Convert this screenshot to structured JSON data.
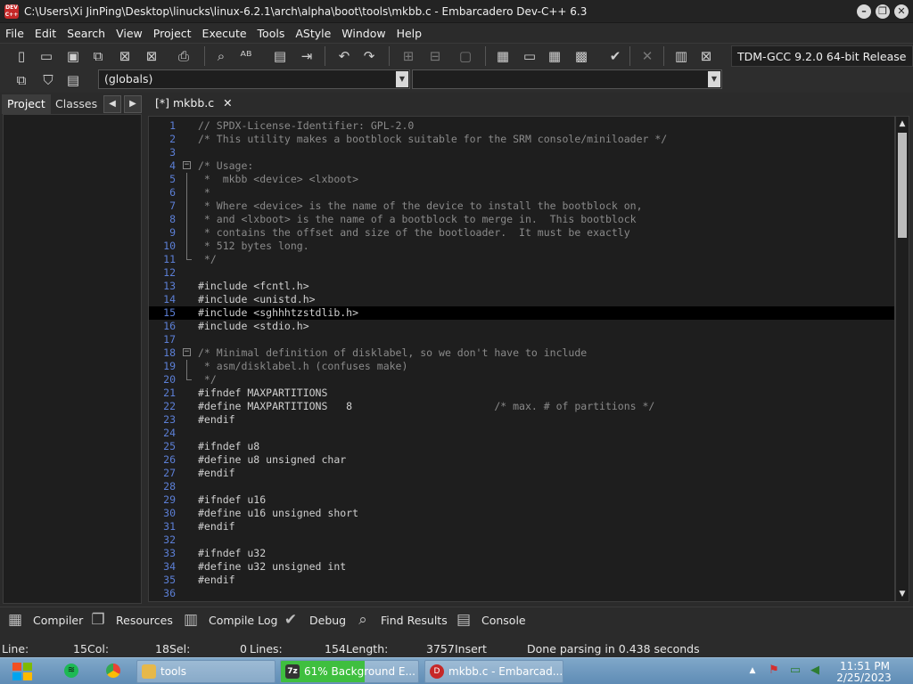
{
  "window": {
    "title": "C:\\Users\\Xi JinPing\\Desktop\\linucks\\linux-6.2.1\\arch\\alpha\\boot\\tools\\mkbb.c - Embarcadero Dev-C++ 6.3",
    "icon_text": "DEV C++",
    "controls": {
      "minimize": "–",
      "restore": "❐",
      "close": "✕"
    }
  },
  "menu": [
    "File",
    "Edit",
    "Search",
    "View",
    "Project",
    "Execute",
    "Tools",
    "AStyle",
    "Window",
    "Help"
  ],
  "toolbar": {
    "compiler": "TDM-GCC 9.2.0 64-bit Release",
    "scope_combo": "(globals)",
    "function_combo": ""
  },
  "left_panel": {
    "tabs": [
      "Project",
      "Classes"
    ],
    "active_tab": "Project",
    "nav_prev": "◀",
    "nav_next": "▶"
  },
  "editor": {
    "tab_label": "[*] mkbb.c",
    "tab_close": "✕",
    "current_line": 15,
    "lines": [
      {
        "n": "1",
        "text": "// SPDX-License-Identifier: GPL-2.0",
        "kind": "comment"
      },
      {
        "n": "2",
        "text": "/* This utility makes a bootblock suitable for the SRM console/miniloader */",
        "kind": "comment"
      },
      {
        "n": "3",
        "text": "",
        "kind": "code"
      },
      {
        "n": "4",
        "text": "/* Usage:",
        "kind": "comment",
        "fold": "start"
      },
      {
        "n": "5",
        "text": " *  mkbb <device> <lxboot>",
        "kind": "comment",
        "fold": "line"
      },
      {
        "n": "6",
        "text": " *",
        "kind": "comment",
        "fold": "line"
      },
      {
        "n": "7",
        "text": " * Where <device> is the name of the device to install the bootblock on,",
        "kind": "comment",
        "fold": "line"
      },
      {
        "n": "8",
        "text": " * and <lxboot> is the name of a bootblock to merge in.  This bootblock",
        "kind": "comment",
        "fold": "line"
      },
      {
        "n": "9",
        "text": " * contains the offset and size of the bootloader.  It must be exactly",
        "kind": "comment",
        "fold": "line"
      },
      {
        "n": "10",
        "text": " * 512 bytes long.",
        "kind": "comment",
        "fold": "line"
      },
      {
        "n": "11",
        "text": " */",
        "kind": "comment",
        "fold": "end"
      },
      {
        "n": "12",
        "text": "",
        "kind": "code"
      },
      {
        "n": "13",
        "text": "#include <fcntl.h>",
        "kind": "pp"
      },
      {
        "n": "14",
        "text": "#include <unistd.h>",
        "kind": "pp"
      },
      {
        "n": "15",
        "text": "#include <sghhhtzstdlib.h>",
        "kind": "pp"
      },
      {
        "n": "16",
        "text": "#include <stdio.h>",
        "kind": "pp"
      },
      {
        "n": "17",
        "text": "",
        "kind": "code"
      },
      {
        "n": "18",
        "text": "/* Minimal definition of disklabel, so we don't have to include",
        "kind": "comment",
        "fold": "start"
      },
      {
        "n": "19",
        "text": " * asm/disklabel.h (confuses make)",
        "kind": "comment",
        "fold": "line"
      },
      {
        "n": "20",
        "text": " */",
        "kind": "comment",
        "fold": "end"
      },
      {
        "n": "21",
        "text": "#ifndef MAXPARTITIONS",
        "kind": "pp"
      },
      {
        "n": "22",
        "text": "#define MAXPARTITIONS   8",
        "trail": "                       /* max. # of partitions */",
        "kind": "pp"
      },
      {
        "n": "23",
        "text": "#endif",
        "kind": "pp"
      },
      {
        "n": "24",
        "text": "",
        "kind": "code"
      },
      {
        "n": "25",
        "text": "#ifndef u8",
        "kind": "pp"
      },
      {
        "n": "26",
        "text": "#define u8 unsigned char",
        "kind": "pp"
      },
      {
        "n": "27",
        "text": "#endif",
        "kind": "pp"
      },
      {
        "n": "28",
        "text": "",
        "kind": "code"
      },
      {
        "n": "29",
        "text": "#ifndef u16",
        "kind": "pp"
      },
      {
        "n": "30",
        "text": "#define u16 unsigned short",
        "kind": "pp"
      },
      {
        "n": "31",
        "text": "#endif",
        "kind": "pp"
      },
      {
        "n": "32",
        "text": "",
        "kind": "code"
      },
      {
        "n": "33",
        "text": "#ifndef u32",
        "kind": "pp"
      },
      {
        "n": "34",
        "text": "#define u32 unsigned int",
        "kind": "pp"
      },
      {
        "n": "35",
        "text": "#endif",
        "kind": "pp"
      },
      {
        "n": "36",
        "text": "",
        "kind": "code"
      }
    ]
  },
  "bottom_tabs": [
    {
      "label": "Compiler",
      "icon": "grid-icon",
      "glyph": "▦"
    },
    {
      "label": "Resources",
      "icon": "resources-icon",
      "glyph": "❐"
    },
    {
      "label": "Compile Log",
      "icon": "chart-icon",
      "glyph": "▥"
    },
    {
      "label": "Debug",
      "icon": "check-icon",
      "glyph": "✔"
    },
    {
      "label": "Find Results",
      "icon": "find-icon",
      "glyph": "⌕"
    },
    {
      "label": "Console",
      "icon": "console-icon",
      "glyph": "▤"
    }
  ],
  "statusbar": {
    "line_label": "Line:",
    "line_value": "15",
    "col_label": "Col:",
    "col_value": "18",
    "sel_label": "Sel:",
    "sel_value": "0",
    "lines_label": "Lines:",
    "lines_value": "154",
    "length_label": "Length:",
    "length_value": "3757",
    "mode": "Insert",
    "message": "Done parsing in 0.438 seconds"
  },
  "taskbar": {
    "items": [
      {
        "label": "tools",
        "icon": "folder-icon",
        "color": "#e6b84a"
      },
      {
        "label": "61% Background E...",
        "icon": "7zip-icon",
        "color": "#333333",
        "progress": 0.61
      },
      {
        "label": "mkbb.c - Embarcad...",
        "icon": "devcpp-icon",
        "color": "#c62828"
      }
    ],
    "time": "11:51 PM",
    "date": "2/25/2023"
  },
  "colors": {
    "line_numbers": "#5c7fd6",
    "comment": "#8a8a8a",
    "progress_green": "#3fbf3f"
  }
}
